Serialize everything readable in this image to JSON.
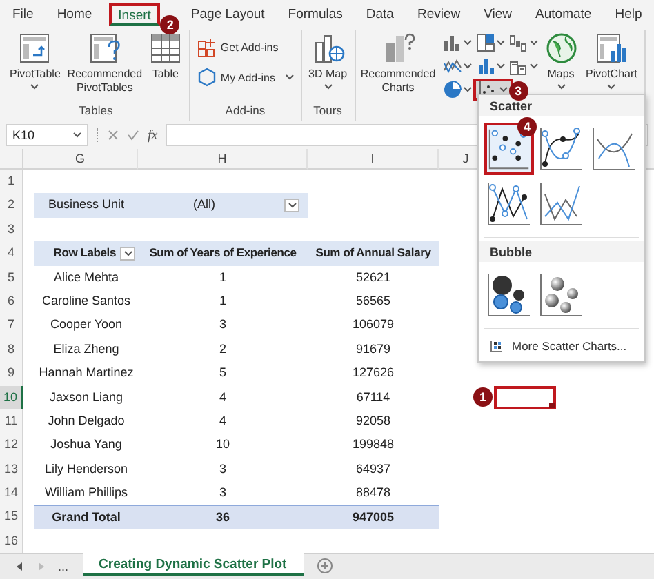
{
  "ribbon_tabs": [
    {
      "label": "File",
      "selected": false
    },
    {
      "label": "Home",
      "selected": false
    },
    {
      "label": "Insert",
      "selected": true,
      "highlighted": true,
      "callout": "2"
    },
    {
      "label": "Page Layout",
      "selected": false
    },
    {
      "label": "Formulas",
      "selected": false
    },
    {
      "label": "Data",
      "selected": false
    },
    {
      "label": "Review",
      "selected": false
    },
    {
      "label": "View",
      "selected": false
    },
    {
      "label": "Automate",
      "selected": false
    },
    {
      "label": "Help",
      "selected": false
    }
  ],
  "ribbon_groups": [
    {
      "label": "Tables",
      "commands": [
        {
          "kind": "large",
          "label": "PivotTable",
          "dropdown": true
        },
        {
          "kind": "large",
          "label": "Recommended PivotTables",
          "dropdown": false
        },
        {
          "kind": "large",
          "label": "Table",
          "dropdown": false
        }
      ]
    },
    {
      "label": "Add-ins",
      "commands": [
        {
          "kind": "small",
          "label": "Get Add-ins",
          "dropdown": false
        },
        {
          "kind": "small",
          "label": "My Add-ins",
          "dropdown": true
        }
      ]
    },
    {
      "label": "Tours",
      "commands": [
        {
          "kind": "large",
          "label": "3D Map",
          "dropdown": true
        }
      ]
    },
    {
      "commands": [
        {
          "kind": "large",
          "label": "Recommended Charts",
          "dropdown": false
        },
        {
          "kind": "grid",
          "buttons": [
            {
              "kind": "column",
              "selected": false
            },
            {
              "kind": "hierarchy",
              "selected": false
            },
            {
              "kind": "waterfall",
              "selected": false
            },
            {
              "kind": "line",
              "selected": false
            },
            {
              "kind": "statistic",
              "selected": false
            },
            {
              "kind": "combo",
              "selected": false
            },
            {
              "kind": "pie",
              "selected": false
            },
            {
              "kind": "scatter",
              "selected": true,
              "highlighted": true,
              "callout": "3"
            }
          ]
        },
        {
          "kind": "large",
          "label": "Maps",
          "dropdown": true
        },
        {
          "kind": "large",
          "label": "PivotChart",
          "dropdown": true
        }
      ]
    }
  ],
  "formula_bar": {
    "name_box": "K10",
    "function_label": "fx"
  },
  "sheet": {
    "columns": [
      {
        "label": "G"
      },
      {
        "label": "H"
      },
      {
        "label": "I"
      },
      {
        "label": "J"
      }
    ],
    "rows": [
      {
        "number": "1",
        "selected": false
      },
      {
        "number": "2",
        "selected": false
      },
      {
        "number": "3",
        "selected": false
      },
      {
        "number": "4",
        "selected": false
      },
      {
        "number": "5",
        "selected": false
      },
      {
        "number": "6",
        "selected": false
      },
      {
        "number": "7",
        "selected": false
      },
      {
        "number": "8",
        "selected": false
      },
      {
        "number": "9",
        "selected": false
      },
      {
        "number": "10",
        "selected": true
      },
      {
        "number": "11",
        "selected": false
      },
      {
        "number": "12",
        "selected": false
      },
      {
        "number": "13",
        "selected": false
      },
      {
        "number": "14",
        "selected": false
      },
      {
        "number": "15",
        "selected": false
      },
      {
        "number": "16",
        "selected": false
      }
    ]
  },
  "pivot": {
    "filter": {
      "label": "Business Unit",
      "value": "(All)"
    },
    "headers": [
      "Row Labels",
      "Sum of Years of Experience",
      "Sum of Annual Salary"
    ],
    "rows": [
      [
        "Alice Mehta",
        "1",
        "52621"
      ],
      [
        "Caroline Santos",
        "1",
        "56565"
      ],
      [
        "Cooper Yoon",
        "3",
        "106079"
      ],
      [
        "Eliza Zheng",
        "2",
        "91679"
      ],
      [
        "Hannah Martinez",
        "5",
        "127626"
      ],
      [
        "Jaxson Liang",
        "4",
        "67114"
      ],
      [
        "John Delgado",
        "4",
        "92058"
      ],
      [
        "Joshua Yang",
        "10",
        "199848"
      ],
      [
        "Lily Henderson",
        "3",
        "64937"
      ],
      [
        "William Phillips",
        "3",
        "88478"
      ]
    ],
    "total": [
      "Grand Total",
      "36",
      "947005"
    ]
  },
  "active_cell": {
    "callout": "1"
  },
  "scatter_menu": {
    "sections": [
      {
        "title": "Scatter",
        "items": [
          {
            "kind": "markers",
            "selected": true,
            "highlighted": true,
            "callout": "4"
          },
          {
            "kind": "smooth-markers",
            "selected": false
          },
          {
            "kind": "smooth",
            "selected": false
          },
          {
            "kind": "straight-markers",
            "selected": false
          },
          {
            "kind": "straight",
            "selected": false
          }
        ]
      },
      {
        "title": "Bubble",
        "items": [
          {
            "kind": "bubble",
            "selected": false
          },
          {
            "kind": "bubble-3d",
            "selected": false
          }
        ]
      }
    ],
    "footer": "More Scatter Charts..."
  },
  "sheet_tabs": {
    "overflow": "...",
    "tabs": [
      {
        "label": "Creating Dynamic Scatter Plot",
        "selected": true
      }
    ]
  }
}
